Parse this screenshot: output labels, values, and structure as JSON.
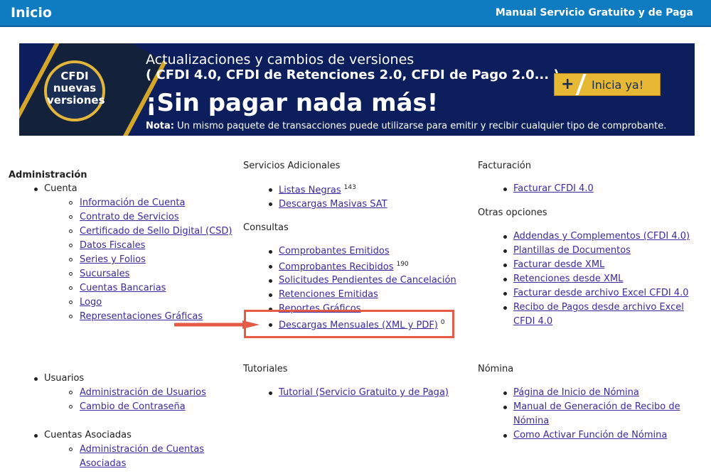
{
  "header": {
    "title": "Inicio",
    "manual_link": "Manual Servicio Gratuito y de Paga"
  },
  "banner": {
    "badge": [
      "CFDI",
      "nuevas",
      "versiones"
    ],
    "line1": "Actualizaciones y cambios de versiones",
    "line2": "( CFDI 4.0, CFDI de Retenciones 2.0, CFDI de Pago 2.0... )",
    "headline": "¡Sin pagar nada más!",
    "note_label": "Nota:",
    "note_text": " Un mismo paquete de transacciones puede utilizarse para emitir y recibir cualquier tipo de comprobante.",
    "cta_plus": "+",
    "cta_label": "Inicia ya!"
  },
  "admin": {
    "title": "Administración",
    "cuenta": "Cuenta",
    "cuenta_items": [
      "Información de Cuenta",
      "Contrato de Servicios",
      "Certificado de Sello Digital (CSD)",
      "Datos Fiscales",
      "Series y Folios",
      "Sucursales",
      "Cuentas Bancarias",
      "Logo",
      "Representaciones Gráficas"
    ],
    "usuarios": "Usuarios",
    "usuarios_items": [
      "Administración de Usuarios",
      "Cambio de Contraseña"
    ],
    "asociadas": "Cuentas Asociadas",
    "asociadas_items": [
      "Administración de Cuentas",
      "Asociadas"
    ]
  },
  "servicios": {
    "title": "Servicios Adicionales",
    "items": [
      "Listas Negras",
      "Descargas Masivas SAT"
    ],
    "listas_count": "143"
  },
  "consultas": {
    "title": "Consultas",
    "items": [
      "Comprobantes Emitidos",
      "Comprobantes Recibidos",
      "Solicitudes Pendientes de Cancelación",
      "Retenciones Emitidas",
      "Reportes Gráficos",
      "Descargas Mensuales (XML y PDF)"
    ],
    "recibidos_count": "190",
    "descargas_count": "0"
  },
  "tutoriales": {
    "title": "Tutoriales",
    "items": [
      "Tutorial (Servicio Gratuito y de Paga)"
    ]
  },
  "facturacion": {
    "title": "Facturación",
    "items": [
      "Facturar CFDI 4.0"
    ]
  },
  "otras": {
    "title": "Otras opciones",
    "items": [
      "Addendas y Complementos (CFDI 4.0)",
      "Plantillas de Documentos",
      "Facturar desde XML",
      "Retenciones desde XML",
      "Facturar desde archivo Excel CFDI 4.0",
      "Recibo de Pagos desde archivo Excel",
      "CFDI 4.0"
    ]
  },
  "nomina": {
    "title": "Nómina",
    "items": [
      "Página de Inicio de Nómina",
      "Manual de Generación de Recibo de",
      "Nómina",
      "Como Activar Función de Nómina"
    ]
  },
  "colors": {
    "header_bg": "#0f7bc1",
    "banner_bg": "#0c1f5c",
    "link": "#3a2aa0",
    "highlight": "#e45a45",
    "cta": "#e6b833"
  }
}
